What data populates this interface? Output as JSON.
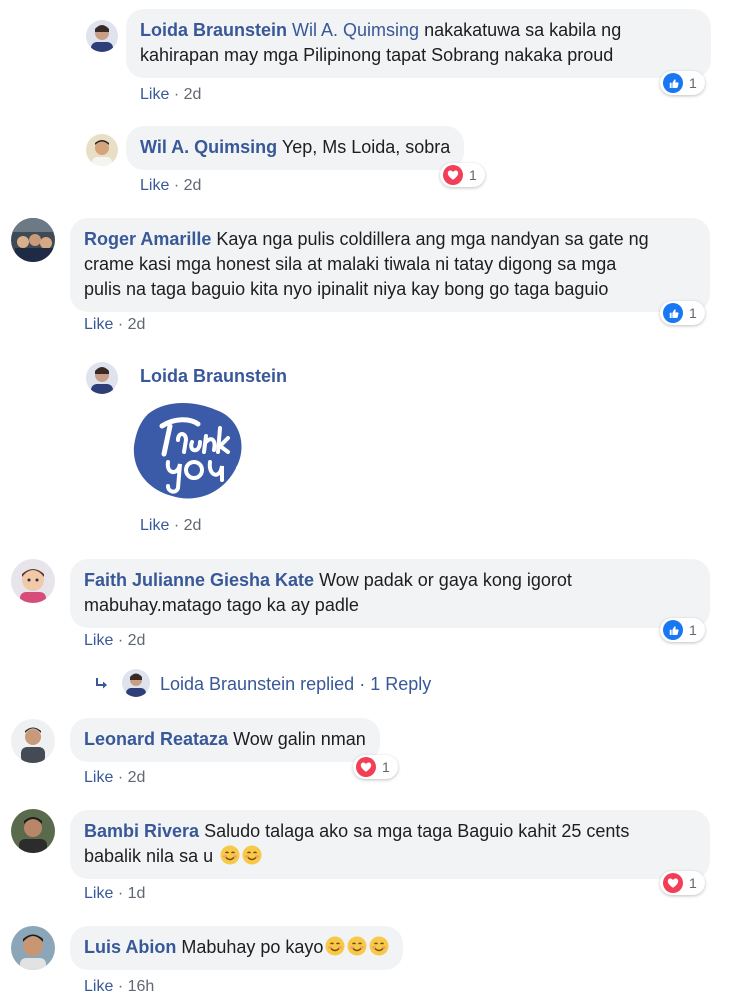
{
  "comments": [
    {
      "author": "Loida Braunstein",
      "mention": "Wil A. Quimsing",
      "text_line1": "nakakatuwa sa kabila ng",
      "text_line2": "kahirapan may mga Pilipinong tapat Sobrang nakaka proud",
      "like": "Like",
      "time": "2d",
      "reaction": "like",
      "reaction_count": "1"
    },
    {
      "author": "Wil A. Quimsing",
      "text": "Yep, Ms Loida, sobra",
      "like": "Like",
      "time": "2d",
      "reaction": "love",
      "reaction_count": "1"
    },
    {
      "author": "Roger Amarille",
      "text_line1": "Kaya nga pulis coldillera ang mga nandyan sa gate ng",
      "text_line2": "crame kasi mga honest sila at malaki tiwala ni tatay digong sa mga",
      "text_line3": "pulis na taga baguio kita nyo ipinalit niya kay bong go taga baguio",
      "like": "Like",
      "time": "2d",
      "reaction": "like",
      "reaction_count": "1"
    },
    {
      "author": "Loida Braunstein",
      "sticker": "Thank you",
      "like": "Like",
      "time": "2d"
    },
    {
      "author": "Faith Julianne Giesha Kate",
      "text_line1": "Wow padak or gaya kong igorot",
      "text_line2": "mabuhay.matago tago ka ay padle",
      "like": "Like",
      "time": "2d",
      "reaction": "like",
      "reaction_count": "1",
      "replies": {
        "author": "Loida Braunstein",
        "replied": "replied",
        "sep": "·",
        "count": "1 Reply"
      }
    },
    {
      "author": "Leonard Reataza",
      "text": "Wow galin nman",
      "like": "Like",
      "time": "2d",
      "reaction": "love",
      "reaction_count": "1"
    },
    {
      "author": "Bambi Rivera",
      "text_line1": "Saludo talaga ako sa mga taga Baguio kahit 25 cents",
      "text_line2": "babalik nila sa u",
      "like": "Like",
      "time": "1d",
      "reaction": "love",
      "reaction_count": "1"
    },
    {
      "author": "Luis Abion",
      "text": "Mabuhay po kayo",
      "like": "Like",
      "time": "16h"
    }
  ],
  "sep": "·",
  "colors": {
    "link": "#385898",
    "bubble": "#f2f3f5",
    "like": "#1877f2",
    "love": "#f33e58",
    "meta": "#606770"
  }
}
